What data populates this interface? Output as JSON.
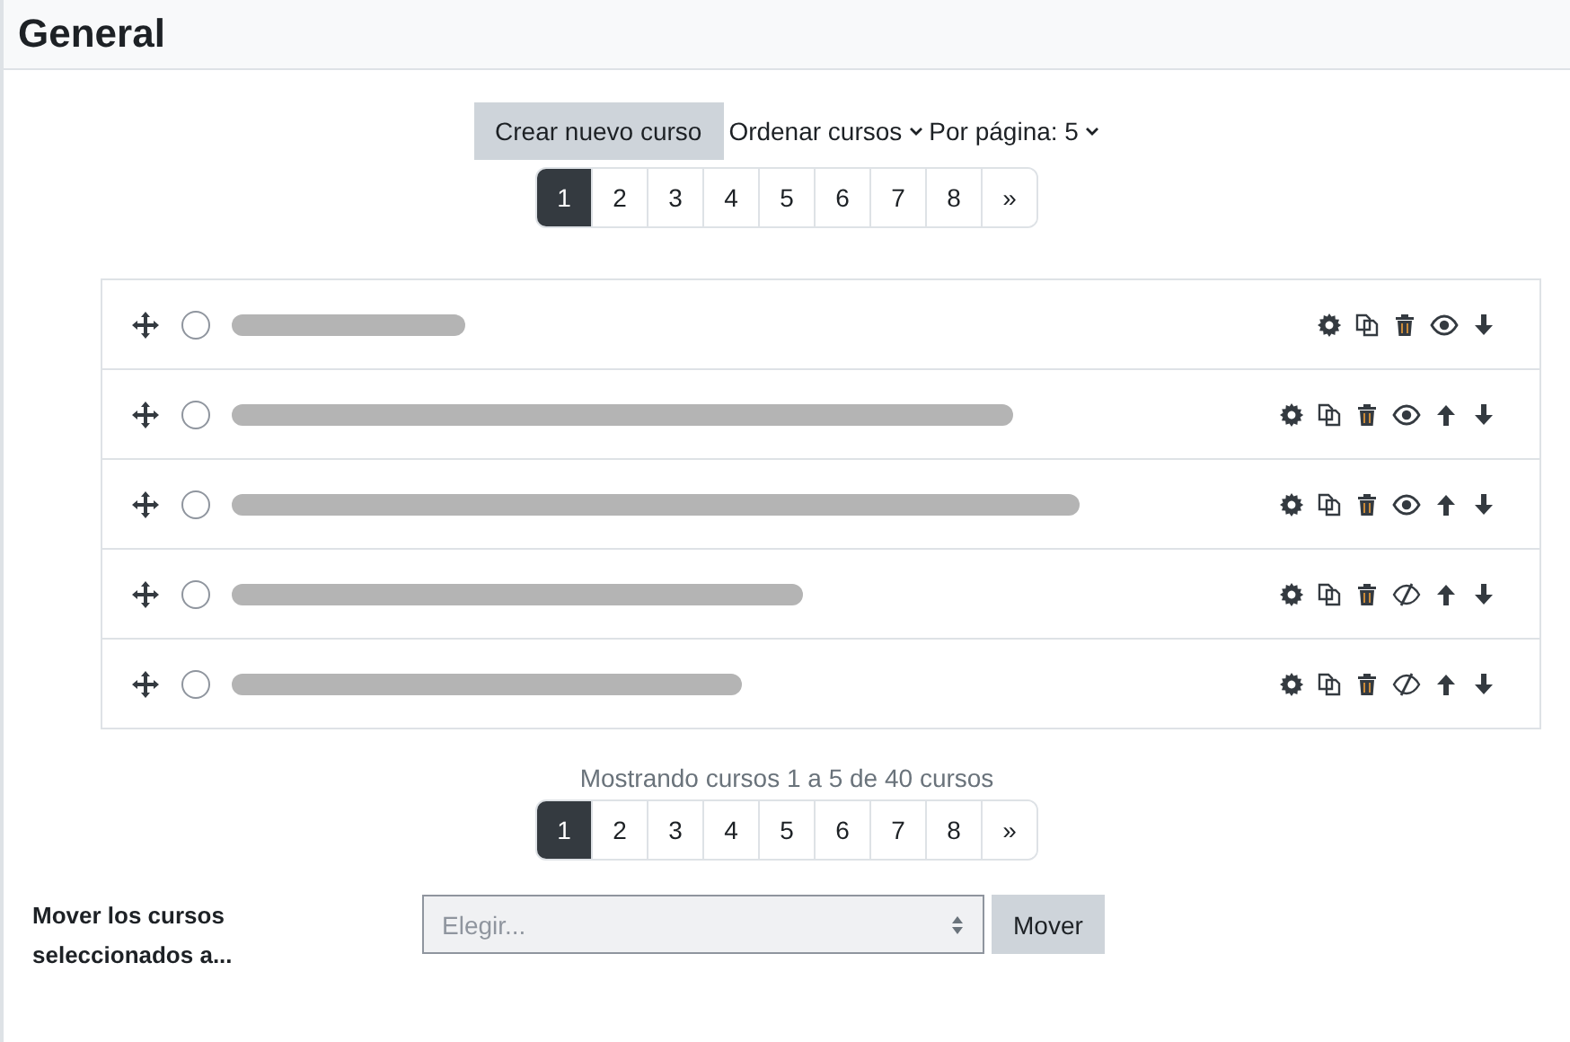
{
  "heading": "General",
  "toolbar": {
    "create_button": "Crear nuevo curso",
    "sort_menu": "Ordenar cursos",
    "per_page_menu": "Por página: 5"
  },
  "pagination_top": [
    {
      "label": "1",
      "selected": true
    },
    {
      "label": "2",
      "selected": false
    },
    {
      "label": "3",
      "selected": false
    },
    {
      "label": "4",
      "selected": false
    },
    {
      "label": "5",
      "selected": false
    },
    {
      "label": "6",
      "selected": false
    },
    {
      "label": "7",
      "selected": false
    },
    {
      "label": "8",
      "selected": false
    },
    {
      "label": "»",
      "selected": false
    }
  ],
  "courses": [
    {
      "checked": false,
      "visible": true,
      "can_move_up": false
    },
    {
      "checked": false,
      "visible": true,
      "can_move_up": true
    },
    {
      "checked": false,
      "visible": true,
      "can_move_up": true
    },
    {
      "checked": false,
      "visible": false,
      "can_move_up": true
    },
    {
      "checked": false,
      "visible": false,
      "can_move_up": true
    }
  ],
  "summary": "Mostrando cursos 1 a 5 de 40 cursos",
  "pagination_bottom": [
    {
      "label": "1",
      "selected": true
    },
    {
      "label": "2",
      "selected": false
    },
    {
      "label": "3",
      "selected": false
    },
    {
      "label": "4",
      "selected": false
    },
    {
      "label": "5",
      "selected": false
    },
    {
      "label": "6",
      "selected": false
    },
    {
      "label": "7",
      "selected": false
    },
    {
      "label": "8",
      "selected": false
    },
    {
      "label": "»",
      "selected": false
    }
  ],
  "move_form": {
    "label": "Mover los cursos seleccionados a...",
    "select": {
      "placeholder": "Elegir..."
    },
    "button": "Mover"
  }
}
